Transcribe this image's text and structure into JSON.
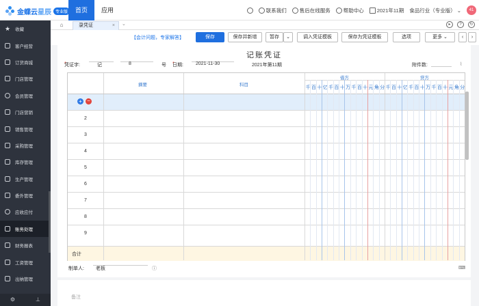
{
  "brand": {
    "name_part1": "金蝶云",
    "name_part2": "星辰",
    "badge": "专业版"
  },
  "topnav": [
    {
      "label": "首页",
      "active": true
    },
    {
      "label": "应用",
      "active": false
    }
  ],
  "topright": {
    "contact": "联系我们",
    "service": "售后在线服务",
    "help": "帮助中心",
    "period": "2021年11期",
    "company": "食品行业（专业版）",
    "avatar": "41"
  },
  "sidebar": [
    {
      "label": "收藏",
      "icon": "star-icon"
    },
    {
      "label": "客户经营",
      "icon": "customer-icon"
    },
    {
      "label": "订货商城",
      "icon": "mall-icon"
    },
    {
      "label": "门店管理",
      "icon": "store-icon"
    },
    {
      "label": "会员管理",
      "icon": "member-icon"
    },
    {
      "label": "门店营销",
      "icon": "tag-icon"
    },
    {
      "label": "销售管理",
      "icon": "sales-icon"
    },
    {
      "label": "采购管理",
      "icon": "purchase-icon"
    },
    {
      "label": "库存管理",
      "icon": "inventory-icon"
    },
    {
      "label": "生产管理",
      "icon": "production-icon"
    },
    {
      "label": "委外管理",
      "icon": "outsource-icon"
    },
    {
      "label": "应收应付",
      "icon": "receivable-icon"
    },
    {
      "label": "账务处理",
      "icon": "accounting-icon",
      "active": true
    },
    {
      "label": "财务报表",
      "icon": "report-icon"
    },
    {
      "label": "工资管理",
      "icon": "salary-icon"
    },
    {
      "label": "出纳管理",
      "icon": "cashier-icon"
    }
  ],
  "tabs": {
    "current": "录凭证",
    "close": "×"
  },
  "toolbar": {
    "help_link": "【会计问题，专家解答】",
    "save": "保存",
    "save_new": "保存并新增",
    "temp_save": "暂存",
    "import_template": "调入凭证模板",
    "save_template": "保存为凭证模板",
    "options": "选项",
    "more": "更多"
  },
  "voucher": {
    "title": "记账凭证",
    "word_label": "凭证字:",
    "word_value": "记",
    "number": "8",
    "number_suffix": "号",
    "date_label": "日期:",
    "date_value": "2021-11-30",
    "period": "2021年第11期",
    "attachments_label": "附件数:"
  },
  "table": {
    "summary_header": "摘要",
    "account_header": "科目",
    "debit_header": "借方",
    "credit_header": "贷方",
    "digits": [
      "千",
      "百",
      "十",
      "亿",
      "千",
      "百",
      "十",
      "万",
      "千",
      "百",
      "十",
      "元",
      "角",
      "分"
    ],
    "rows": [
      "",
      "2",
      "3",
      "4",
      "5",
      "6",
      "7",
      "8",
      "9"
    ],
    "total_label": "合计"
  },
  "footer": {
    "maker_label": "制单人:",
    "maker_value": "老板"
  },
  "remark": {
    "placeholder": "备注"
  }
}
